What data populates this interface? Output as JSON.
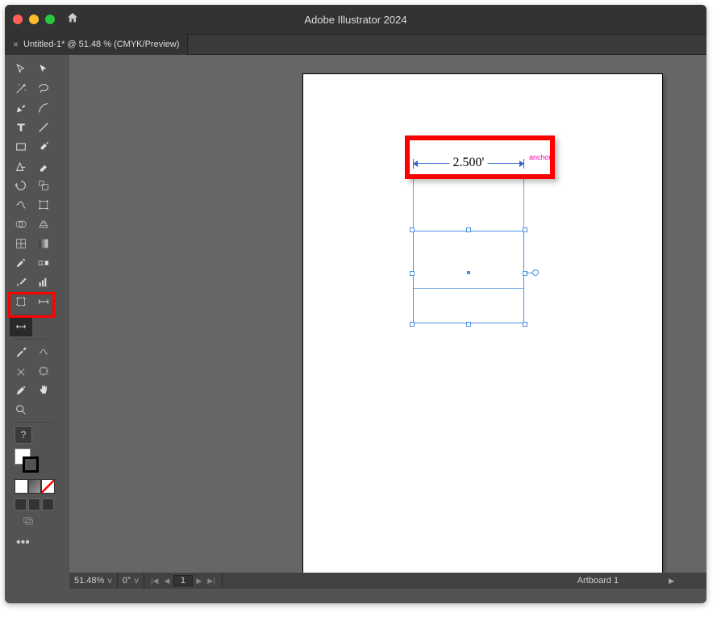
{
  "app": {
    "title": "Adobe Illustrator 2024"
  },
  "tab": {
    "label": "Untitled-1* @ 51.48 % (CMYK/Preview)",
    "close": "×"
  },
  "status": {
    "zoom": "51.48%",
    "rotation": "0°",
    "page": "1",
    "artboard": "Artboard 1"
  },
  "dimension": {
    "value": "2.500'",
    "anchor": "anchor"
  },
  "tools": {
    "question": "?"
  },
  "icons": {
    "home": "⌂",
    "more": "•••",
    "chev": "ᐯ",
    "nav_first": "⏮",
    "nav_prev": "◀",
    "nav_next": "▶",
    "nav_last": "⏭",
    "nav_play": "▶"
  }
}
